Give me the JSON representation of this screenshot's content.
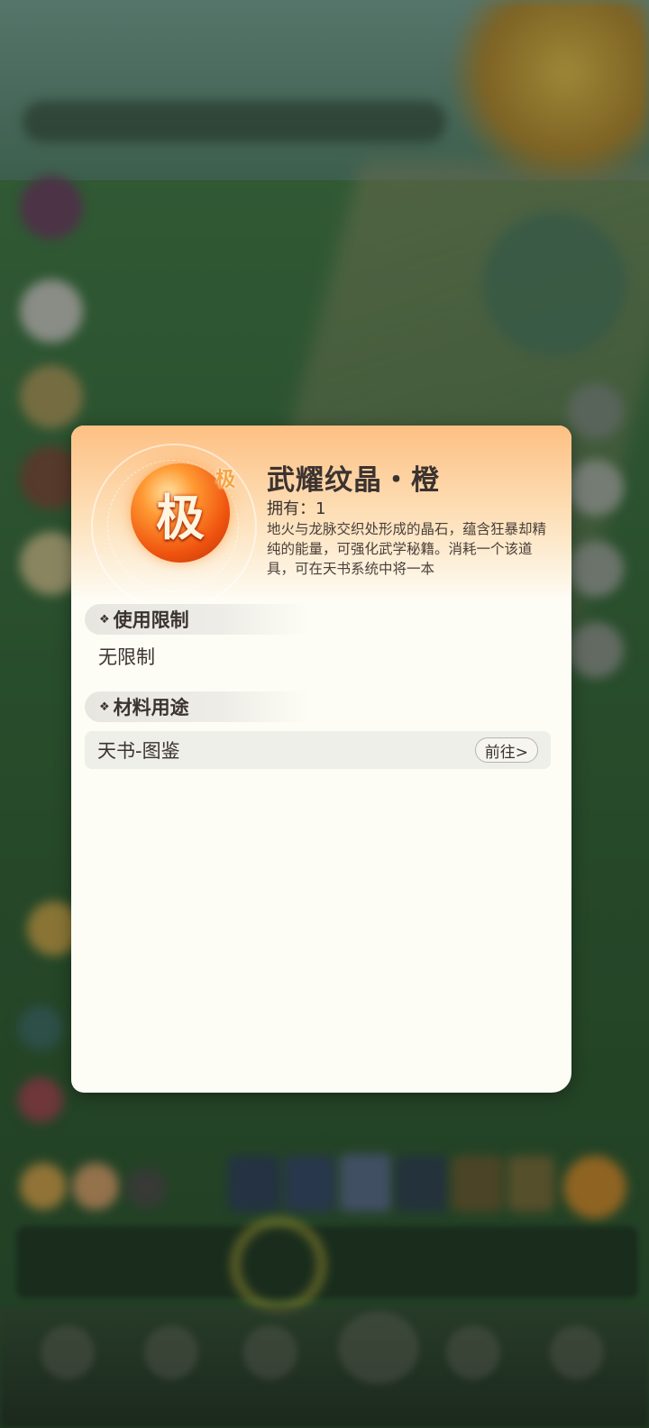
{
  "item": {
    "grade_char": "极",
    "grade_badge": "极",
    "name": "武耀纹晶・橙",
    "own_label": "拥有：",
    "own_count": "1",
    "description": "地火与龙脉交织处形成的晶石，蕴含狂暴却精纯的能量，可强化武学秘籍。消耗一个该道具，可在天书系统中将一本"
  },
  "sections": {
    "restriction": {
      "title": "使用限制",
      "body": "无限制"
    },
    "usage": {
      "title": "材料用途",
      "rows": [
        {
          "label": "天书-图鉴",
          "button": "前往>"
        }
      ]
    }
  },
  "icons": {
    "section_marker": "❖"
  },
  "colors": {
    "accent": "#fdc083",
    "orb": "#f0540f",
    "badge": "#f7a440"
  }
}
